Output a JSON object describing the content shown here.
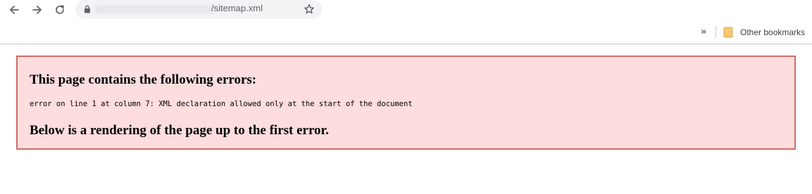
{
  "browser": {
    "address_bar": {
      "url_suffix": "/sitemap.xml",
      "lock_icon": "lock-icon",
      "star_icon": "star-icon"
    },
    "nav": {
      "back_icon": "back-arrow-icon",
      "forward_icon": "forward-arrow-icon",
      "reload_icon": "reload-icon"
    },
    "bookmarks_bar": {
      "overflow_label": "»",
      "other_bookmarks_label": "Other bookmarks",
      "folder_icon": "folder-icon",
      "folder_color": "#f6c870"
    }
  },
  "error_page": {
    "heading": "This page contains the following errors:",
    "message": "error on line 1 at column 7: XML declaration allowed only at the start of the document",
    "rendering_note": "Below is a rendering of the page up to the first error.",
    "box_background": "#fddddd",
    "box_border": "#d06b6b"
  }
}
